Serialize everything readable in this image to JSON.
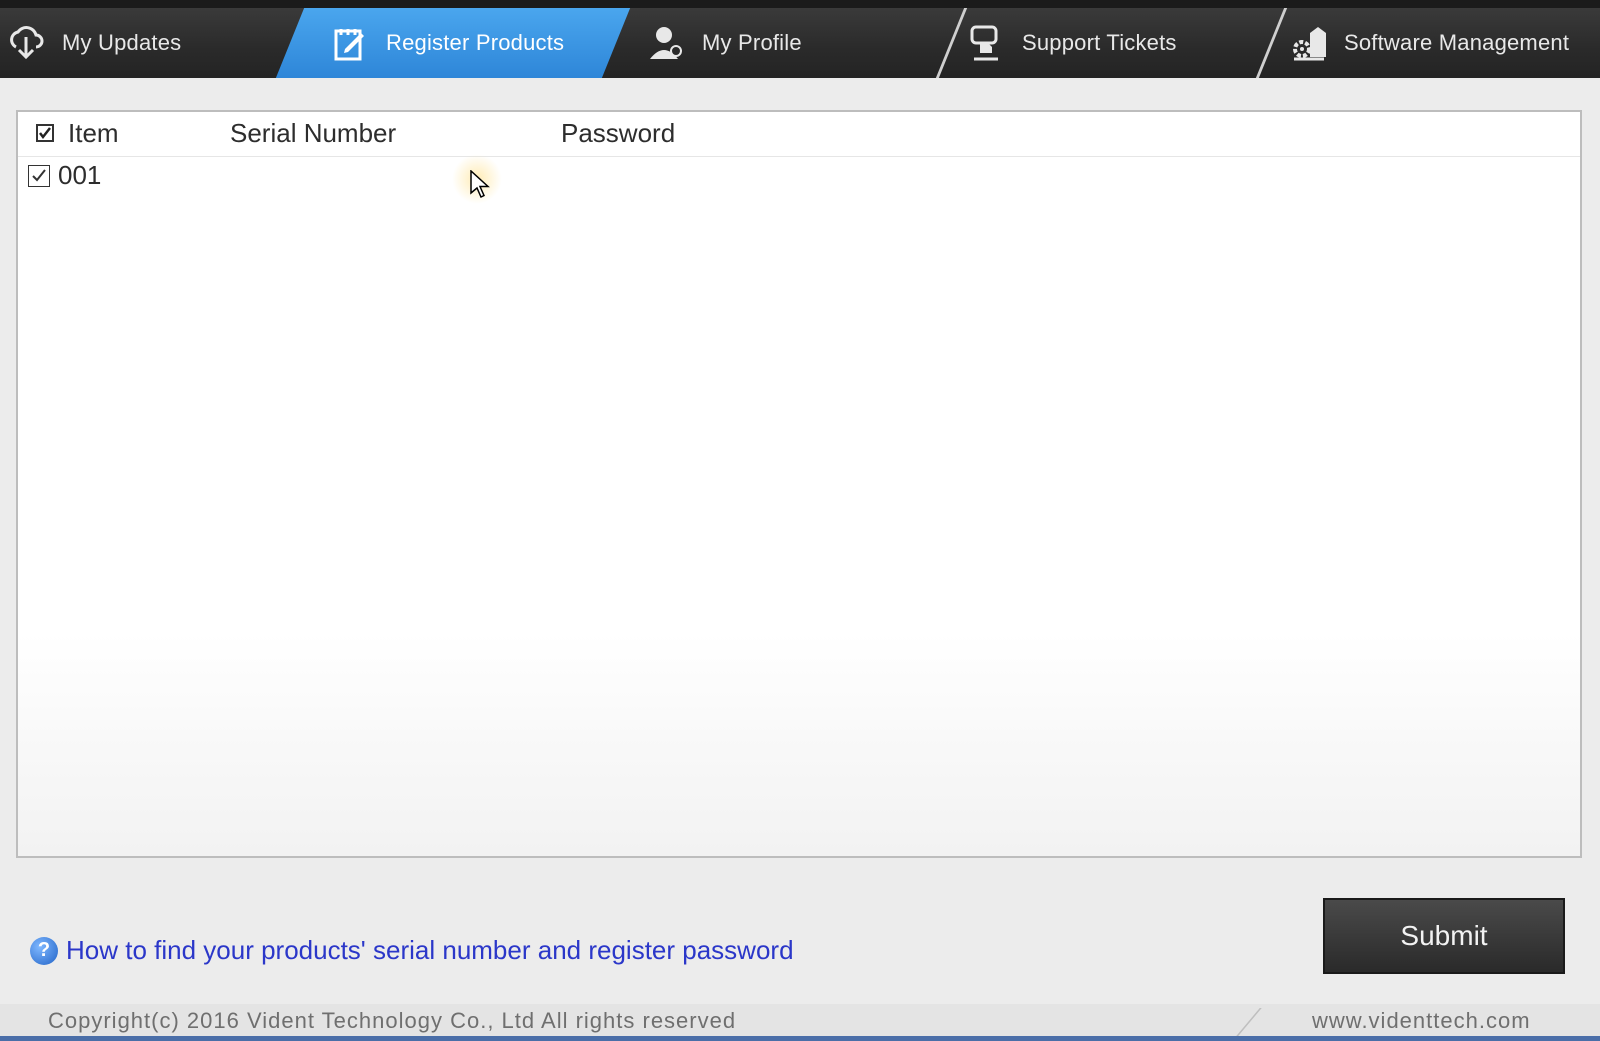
{
  "nav": {
    "tabs": [
      {
        "label": "My Updates",
        "icon": "cloud-download-icon"
      },
      {
        "label": "Register Products",
        "icon": "register-pencil-icon",
        "active": true
      },
      {
        "label": "My Profile",
        "icon": "user-profile-icon"
      },
      {
        "label": "Support Tickets",
        "icon": "support-hand-icon"
      },
      {
        "label": "Software Management",
        "icon": "gear-house-icon"
      }
    ],
    "active_color": "#2e86d8"
  },
  "table": {
    "columns": [
      "Item",
      "Serial Number",
      "Password"
    ],
    "header_checked": true,
    "rows": [
      {
        "item": "001",
        "serial": "",
        "password": "",
        "checked": true
      }
    ]
  },
  "help_link": "How to find your products' serial number and register password",
  "submit_label": "Submit",
  "footer": {
    "copyright": "Copyright(c) 2016 Vident Technology Co., Ltd All rights reserved",
    "website": "www.videnttech.com"
  }
}
